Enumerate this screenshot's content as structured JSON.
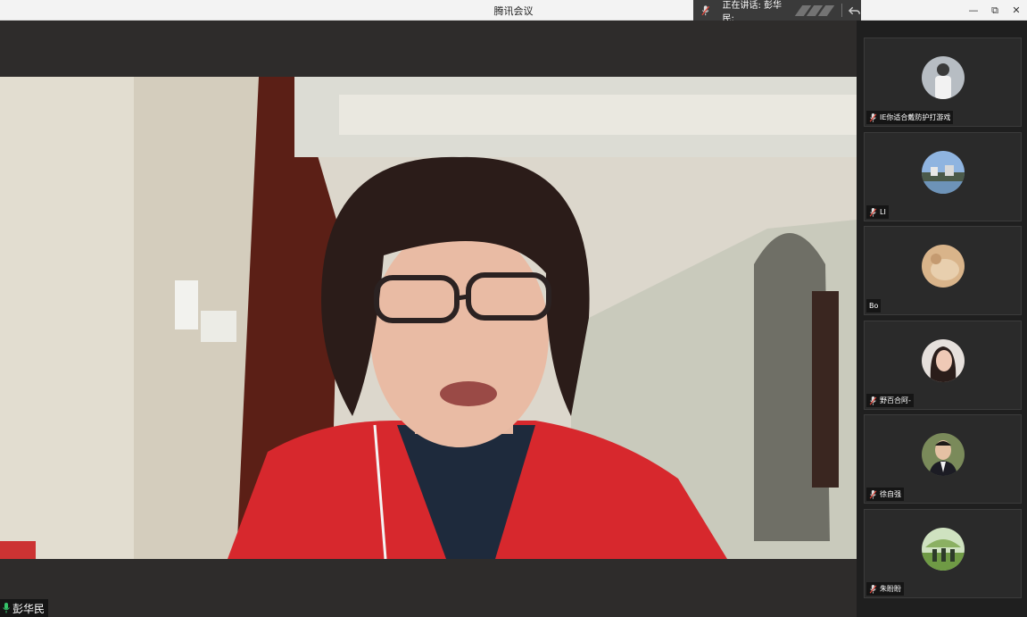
{
  "app": {
    "title": "腾讯会议"
  },
  "speaking_indicator": {
    "label": "正在讲话: 彭华民;"
  },
  "window_controls": {
    "minimize": "—",
    "restore": "⧉",
    "close": "✕"
  },
  "main_video": {
    "speaker_name": "彭华民"
  },
  "participants": [
    {
      "name": "IE你适合戴防护打游戏",
      "muted": true
    },
    {
      "name": "LI",
      "muted": true
    },
    {
      "name": "Bo",
      "muted": false
    },
    {
      "name": "野百合阿-",
      "muted": true
    },
    {
      "name": "徐自强",
      "muted": true
    },
    {
      "name": "朱盼盼",
      "muted": true
    }
  ],
  "colors": {
    "mic_active": "#35c46a",
    "mic_muted": "#e0473b",
    "accent_bg": "#2e2c2b"
  }
}
